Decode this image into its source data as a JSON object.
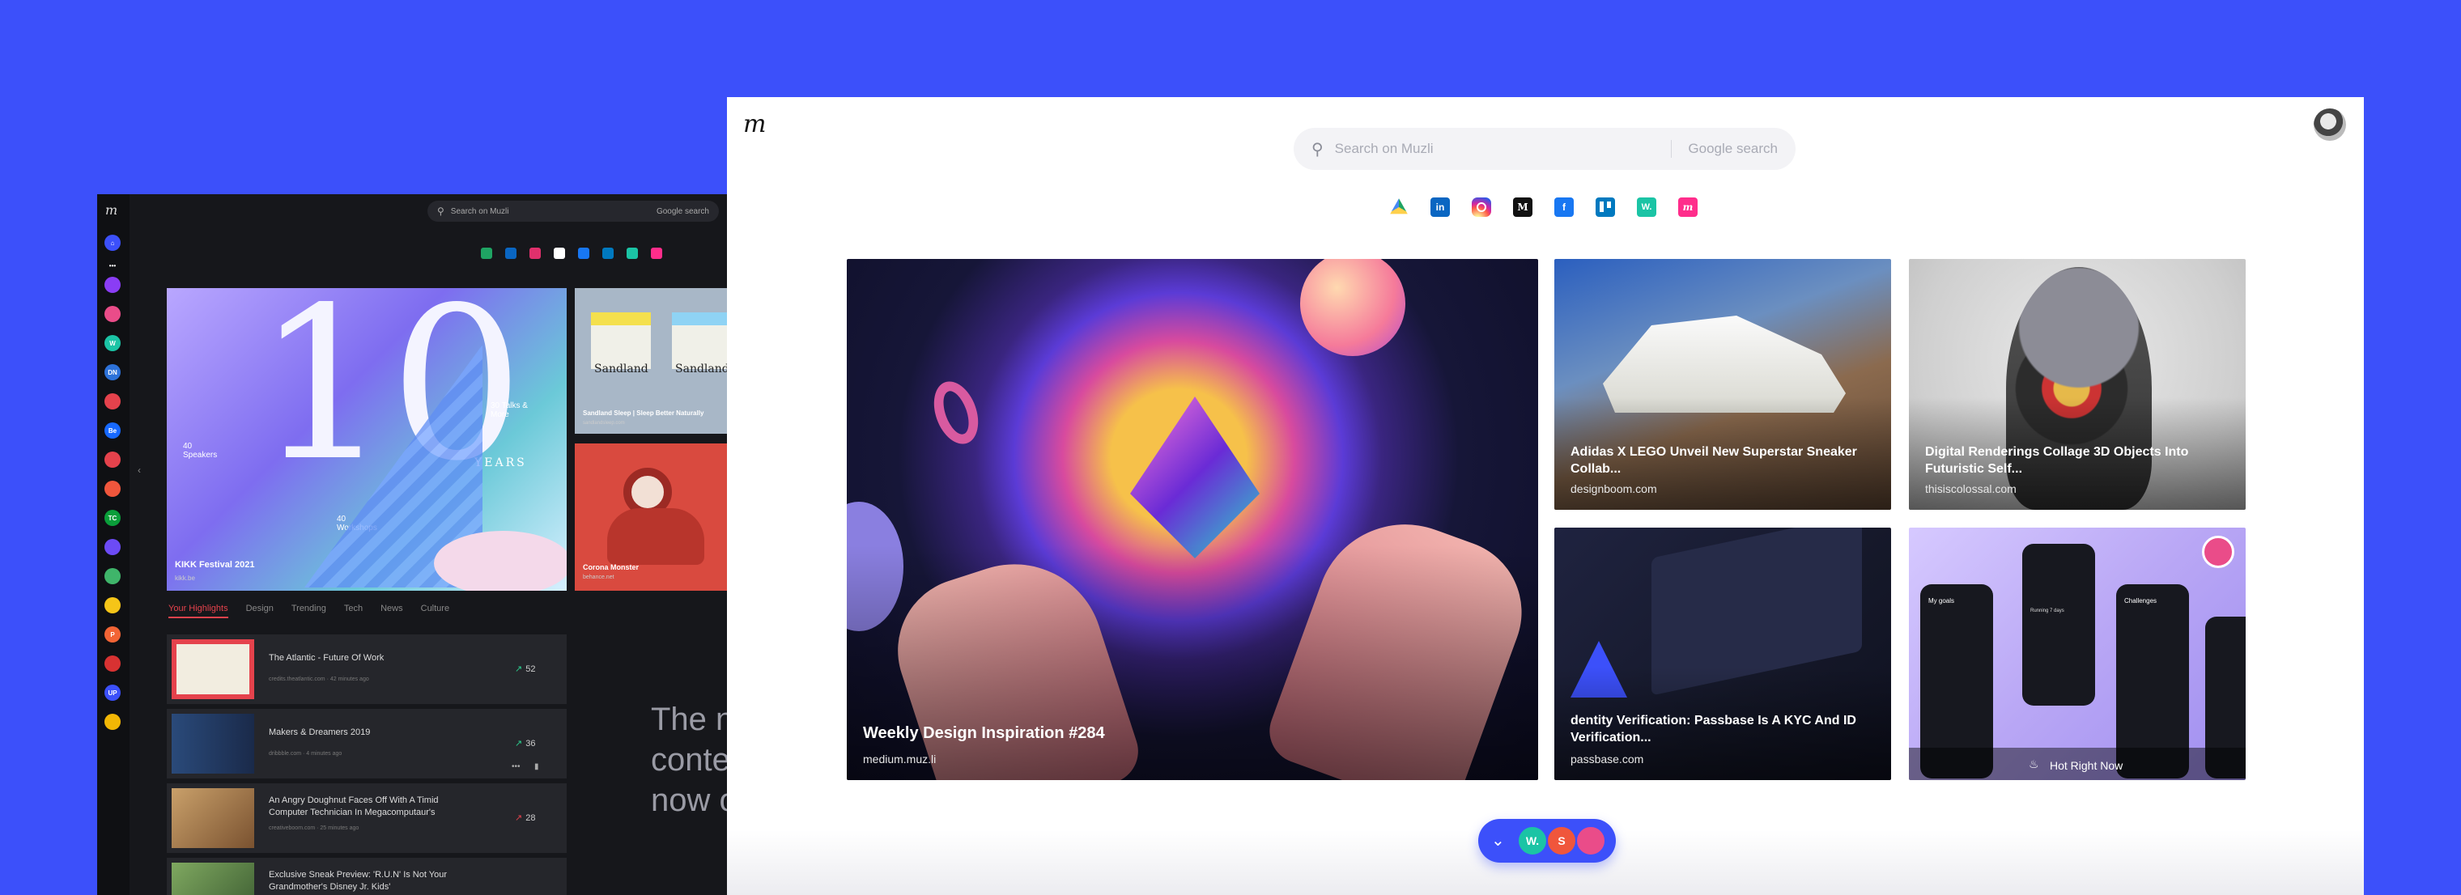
{
  "colors": {
    "background": "#3c50fa",
    "accent": "#3c50fa"
  },
  "dark_app": {
    "search": {
      "placeholder": "Search on Muzli",
      "google_label": "Google search"
    },
    "tiles": [
      {
        "title": "KIKK Festival 2021",
        "source": "kikk.be"
      },
      {
        "title": "Sandland Sleep | Sleep Better Naturally",
        "source": "sandlandsleep.com"
      },
      {
        "title": "Corona Monster",
        "source": "behance.net"
      }
    ],
    "tile_art": {
      "numeral": "10",
      "years": "YEARS",
      "speakers": "40 Speakers",
      "workshops": "40 Workshops",
      "talks": "30 Talks & More",
      "brand_left": "Sandland",
      "brand_right": "Sandland"
    },
    "tabs": [
      "Your Highlights",
      "Design",
      "Trending",
      "Tech",
      "News",
      "Culture"
    ],
    "rows": [
      {
        "title": "The Atlantic - Future Of Work",
        "meta": "credits.theatlantic.com · 42 minutes ago",
        "count": "52"
      },
      {
        "title": "Makers & Dreamers 2019",
        "meta": "dribbble.com · 4 minutes ago",
        "count": "36"
      },
      {
        "title": "An Angry Doughnut Faces Off With A Timid Computer Technician In Megacomputaur's",
        "meta": "creativeboom.com · 25 minutes ago",
        "count": "28"
      },
      {
        "title": "Exclusive Sneak Preview: 'R.U.N' Is Not Your Grandmother's Disney Jr. Kids'",
        "meta": "",
        "count": ""
      }
    ],
    "tagline_lines": [
      "The n",
      "conte",
      "now o"
    ]
  },
  "header": {
    "logo": "m",
    "search_placeholder": "Search on Muzli",
    "google_search_label": "Google search"
  },
  "quick_links": [
    {
      "icon": "google-drive-icon",
      "label": ""
    },
    {
      "icon": "linkedin-icon",
      "label": "in"
    },
    {
      "icon": "instagram-icon",
      "label": ""
    },
    {
      "icon": "medium-icon",
      "label": "M"
    },
    {
      "icon": "facebook-icon",
      "label": "f"
    },
    {
      "icon": "trello-icon",
      "label": ""
    },
    {
      "icon": "webflow-icon",
      "label": "W."
    },
    {
      "icon": "muzli-icon",
      "label": "m"
    }
  ],
  "cards": [
    {
      "title": "Weekly Design Inspiration #284",
      "source": "medium.muz.li"
    },
    {
      "title": "Adidas X LEGO Unveil New Superstar Sneaker Collab...",
      "source": "designboom.com"
    },
    {
      "title": "Digital Renderings Collage 3D Objects Into Futuristic Self...",
      "source": "thisiscolossal.com"
    },
    {
      "title": "dentity Verification: Passbase Is A KYC And ID Verification...",
      "source": "passbase.com"
    },
    {
      "title": "Hot Right Now",
      "source": ""
    }
  ],
  "card_details": {
    "goals_label": "My goals",
    "challenges_label": "Challenges",
    "running_label": "Running 7 days"
  },
  "bottom_bar": {
    "icons": [
      "webflow-icon",
      "smashing-icon",
      "dribbble-icon"
    ],
    "labels": [
      "W.",
      "S",
      ""
    ]
  }
}
